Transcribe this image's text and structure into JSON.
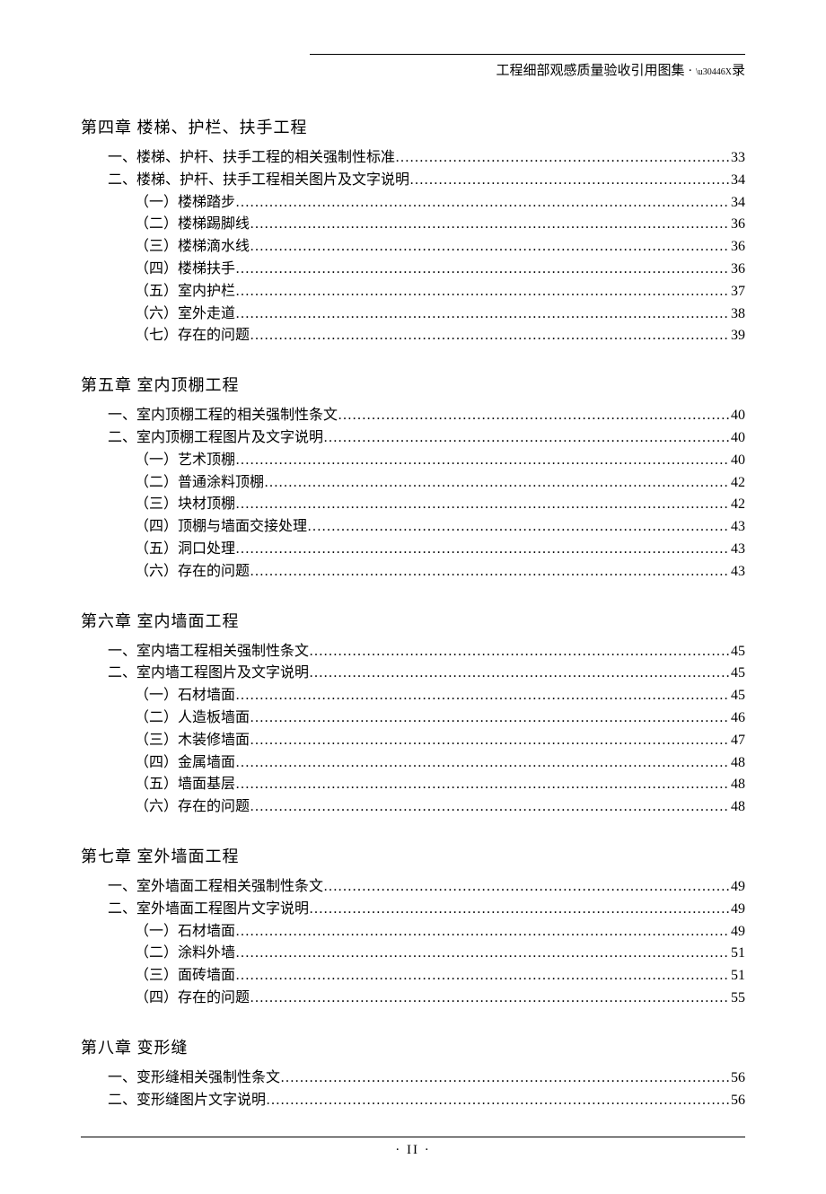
{
  "running_head": {
    "title": "工程细部观感质量验收引用图集",
    "sep": "·",
    "tail_small": "\\u30446X",
    "tail": "录"
  },
  "page_number": "·  II  ·",
  "chapters": [
    {
      "title": "第四章   楼梯、护栏、扶手工程",
      "sections": [
        {
          "label": "一、楼梯、护杆、扶手工程的相关强制性标准",
          "page": "33",
          "level": 1
        },
        {
          "label": "二、楼梯、护杆、扶手工程相关图片及文字说明",
          "page": "34",
          "level": 1
        },
        {
          "label": "（一）楼梯踏步",
          "page": "34",
          "level": 2
        },
        {
          "label": "（二）楼梯踢脚线",
          "page": "36",
          "level": 2
        },
        {
          "label": "（三）楼梯滴水线",
          "page": "36",
          "level": 2
        },
        {
          "label": "（四）楼梯扶手",
          "page": "36",
          "level": 2
        },
        {
          "label": "（五）室内护栏",
          "page": "37",
          "level": 2
        },
        {
          "label": "（六）室外走道",
          "page": "38",
          "level": 2
        },
        {
          "label": "（七）存在的问题",
          "page": "39",
          "level": 2
        }
      ]
    },
    {
      "title": "第五章   室内顶棚工程",
      "sections": [
        {
          "label": "一、室内顶棚工程的相关强制性条文",
          "page": "40",
          "level": 1
        },
        {
          "label": "二、室内顶棚工程图片及文字说明",
          "page": "40",
          "level": 1
        },
        {
          "label": "（一）艺术顶棚",
          "page": "40",
          "level": 2
        },
        {
          "label": "（二）普通涂料顶棚",
          "page": "42",
          "level": 2
        },
        {
          "label": "（三）块材顶棚",
          "page": "42",
          "level": 2
        },
        {
          "label": "（四）顶棚与墙面交接处理",
          "page": "43",
          "level": 2
        },
        {
          "label": "（五）洞口处理",
          "page": "43",
          "level": 2
        },
        {
          "label": "（六）存在的问题",
          "page": "43",
          "level": 2
        }
      ]
    },
    {
      "title": "第六章   室内墙面工程",
      "sections": [
        {
          "label": "一、室内墙工程相关强制性条文",
          "page": "45",
          "level": 1
        },
        {
          "label": "二、室内墙工程图片及文字说明",
          "page": "45",
          "level": 1
        },
        {
          "label": "（一）石材墙面",
          "page": "45",
          "level": 2
        },
        {
          "label": "（二）人造板墙面",
          "page": "46",
          "level": 2
        },
        {
          "label": "（三）木装修墙面",
          "page": "47",
          "level": 2
        },
        {
          "label": "（四）金属墙面",
          "page": "48",
          "level": 2
        },
        {
          "label": "（五）墙面基层",
          "page": "48",
          "level": 2
        },
        {
          "label": "（六）存在的问题",
          "page": "48",
          "level": 2
        }
      ]
    },
    {
      "title": "第七章   室外墙面工程",
      "sections": [
        {
          "label": "一、室外墙面工程相关强制性条文",
          "page": "49",
          "level": 1
        },
        {
          "label": "二、室外墙面工程图片文字说明",
          "page": "49",
          "level": 1
        },
        {
          "label": "（一）石材墙面",
          "page": "49",
          "level": 2
        },
        {
          "label": "（二）涂料外墙",
          "page": "51",
          "level": 2
        },
        {
          "label": "（三）面砖墙面",
          "page": "51",
          "level": 2
        },
        {
          "label": "（四）存在的问题",
          "page": "55",
          "level": 2
        }
      ]
    },
    {
      "title": "第八章   变形缝",
      "sections": [
        {
          "label": "一、变形缝相关强制性条文",
          "page": "56",
          "level": 1
        },
        {
          "label": "二、变形缝图片文字说明",
          "page": "56",
          "level": 1
        }
      ]
    }
  ]
}
